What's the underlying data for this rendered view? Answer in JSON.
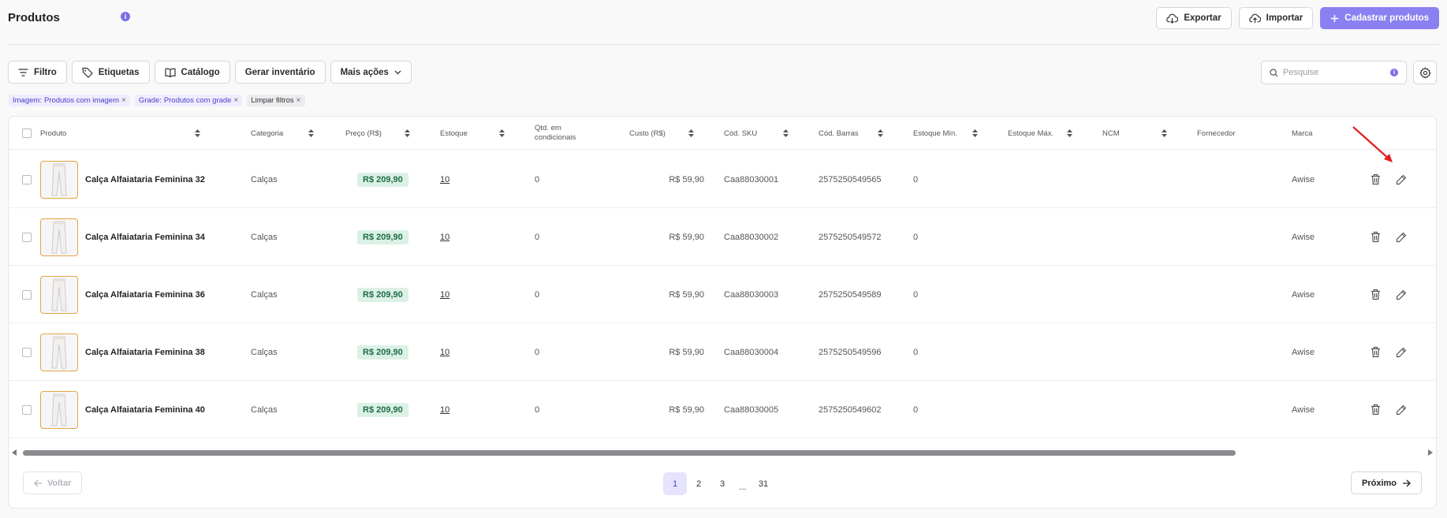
{
  "page": {
    "title": "Produtos"
  },
  "header_actions": {
    "export_label": "Exportar",
    "import_label": "Importar",
    "create_label": "Cadastrar produtos"
  },
  "toolbar": {
    "filter_label": "Filtro",
    "tags_label": "Etiquetas",
    "catalog_label": "Catálogo",
    "inventory_label": "Gerar inventário",
    "more_label": "Mais ações"
  },
  "search": {
    "placeholder": "Pesquise",
    "value": ""
  },
  "filters": {
    "chips": [
      {
        "key": "Imagem:",
        "value": "Produtos com imagem"
      },
      {
        "key": "Grade:",
        "value": "Produtos com grade"
      }
    ],
    "clear_label": "Limpar filtros"
  },
  "table": {
    "columns": {
      "product": "Produto",
      "category": "Categoria",
      "price": "Preço (R$)",
      "stock": "Estoque",
      "qty_line1": "Qtd. em",
      "qty_line2": "condicionais",
      "cost": "Custo (R$)",
      "sku": "Cód. SKU",
      "barcode": "Cód. Barras",
      "stock_min": "Estoque Mín.",
      "stock_max": "Estoque Máx.",
      "ncm": "NCM",
      "supplier": "Fornecedor",
      "brand": "Marca"
    },
    "rows": [
      {
        "name": "Calça Alfaiataria Feminina 32",
        "category": "Calças",
        "price": "R$ 209,90",
        "stock": "10",
        "qty": "0",
        "cost": "R$ 59,90",
        "sku": "Caa88030001",
        "barcode": "2575250549565",
        "stock_min": "0",
        "brand": "Awise"
      },
      {
        "name": "Calça Alfaiataria Feminina 34",
        "category": "Calças",
        "price": "R$ 209,90",
        "stock": "10",
        "qty": "0",
        "cost": "R$ 59,90",
        "sku": "Caa88030002",
        "barcode": "2575250549572",
        "stock_min": "0",
        "brand": "Awise"
      },
      {
        "name": "Calça Alfaiataria Feminina 36",
        "category": "Calças",
        "price": "R$ 209,90",
        "stock": "10",
        "qty": "0",
        "cost": "R$ 59,90",
        "sku": "Caa88030003",
        "barcode": "2575250549589",
        "stock_min": "0",
        "brand": "Awise"
      },
      {
        "name": "Calça Alfaiataria Feminina 38",
        "category": "Calças",
        "price": "R$ 209,90",
        "stock": "10",
        "qty": "0",
        "cost": "R$ 59,90",
        "sku": "Caa88030004",
        "barcode": "2575250549596",
        "stock_min": "0",
        "brand": "Awise"
      },
      {
        "name": "Calça Alfaiataria Feminina 40",
        "category": "Calças",
        "price": "R$ 209,90",
        "stock": "10",
        "qty": "0",
        "cost": "R$ 59,90",
        "sku": "Caa88030005",
        "barcode": "2575250549602",
        "stock_min": "0",
        "brand": "Awise"
      }
    ]
  },
  "pagination": {
    "prev_label": "Voltar",
    "next_label": "Próximo",
    "pages": [
      "1",
      "2",
      "3",
      "...",
      "31"
    ],
    "current": "1"
  },
  "colors": {
    "accent": "#8b80f1",
    "price_bg": "#dbf1e6",
    "price_text": "#1e6c47",
    "annotation_arrow": "#e02020"
  },
  "icons": [
    "info-icon",
    "cloud-download-icon",
    "cloud-upload-icon",
    "plus-icon",
    "filter-lines-icon",
    "tag-icon",
    "book-icon",
    "chevron-down-icon",
    "search-icon",
    "gear-icon",
    "sort-icon",
    "trash-icon",
    "pencil-icon",
    "arrow-left-icon",
    "arrow-right-icon"
  ]
}
